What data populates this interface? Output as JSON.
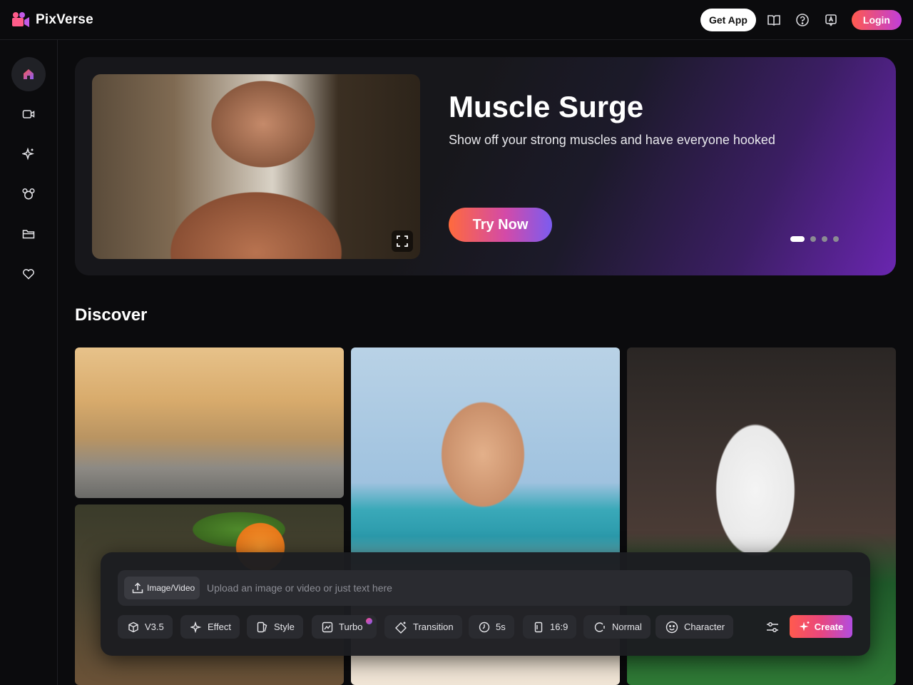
{
  "app": {
    "name": "PixVerse"
  },
  "header": {
    "get_app": "Get App",
    "login": "Login"
  },
  "sidebar": {
    "items": [
      "home-icon",
      "video-icon",
      "sparkle-icon",
      "mouse-ears-icon",
      "folder-icon",
      "heart-icon"
    ]
  },
  "hero": {
    "title": "Muscle Surge",
    "subtitle": "Show off your strong muscles and have everyone hooked",
    "cta": "Try Now",
    "slide_count": 4,
    "active_slide": 1
  },
  "discover": {
    "title": "Discover"
  },
  "composer": {
    "upload_label": "Image/Video",
    "placeholder": "Upload an image or video or just text here",
    "chips": {
      "model": "V3.5",
      "effect": "Effect",
      "style": "Style",
      "turbo": "Turbo",
      "transition": "Transition",
      "duration": "5s",
      "ratio": "16:9",
      "motion": "Normal",
      "character": "Character"
    },
    "create": "Create"
  },
  "colors": {
    "accent_start": "#ff5a4e",
    "accent_end": "#c13ed9",
    "background": "#0b0b0d"
  }
}
